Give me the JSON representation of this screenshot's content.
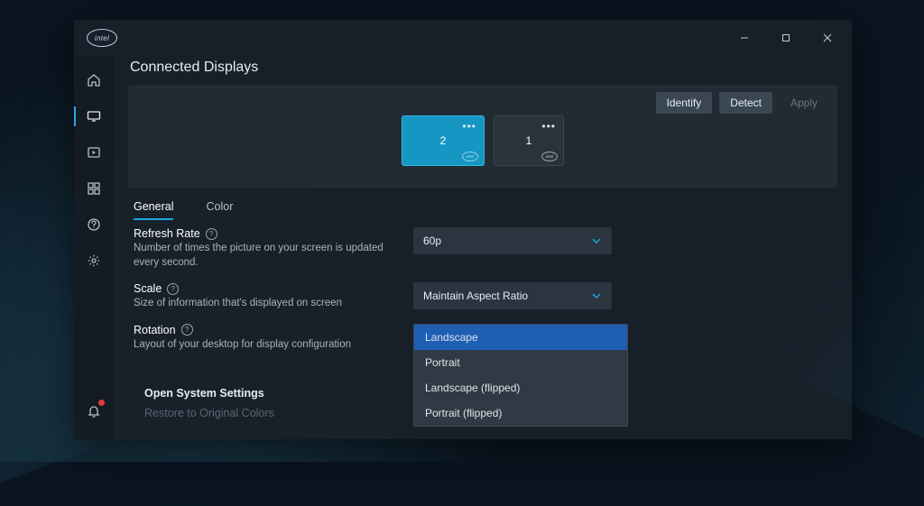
{
  "brand": "intel",
  "window_controls": {
    "min": "minimize",
    "max": "maximize",
    "close": "close"
  },
  "sidebar": {
    "items": [
      {
        "name": "home"
      },
      {
        "name": "display",
        "active": true
      },
      {
        "name": "video"
      },
      {
        "name": "apps"
      },
      {
        "name": "help"
      },
      {
        "name": "settings"
      }
    ],
    "bottom": {
      "name": "notifications",
      "has_badge": true
    }
  },
  "page": {
    "title": "Connected Displays",
    "actions": {
      "identify": "Identify",
      "detect": "Detect",
      "apply": "Apply"
    },
    "displays": [
      {
        "id": "2",
        "primary": true
      },
      {
        "id": "1",
        "primary": false
      }
    ],
    "tabs": {
      "general": "General",
      "color": "Color",
      "active": "general"
    },
    "settings": {
      "refresh": {
        "label": "Refresh Rate",
        "desc": "Number of times the picture on your screen is updated every second.",
        "value": "60p"
      },
      "scale": {
        "label": "Scale",
        "desc": "Size of information that's displayed on screen",
        "value": "Maintain Aspect Ratio"
      },
      "rotation": {
        "label": "Rotation",
        "desc": "Layout of your desktop for display configuration",
        "options": [
          "Landscape",
          "Portrait",
          "Landscape (flipped)",
          "Portrait (flipped)"
        ],
        "selected": "Landscape"
      }
    },
    "footer": {
      "open_system": "Open System Settings",
      "restore": "Restore to Original Colors"
    }
  }
}
